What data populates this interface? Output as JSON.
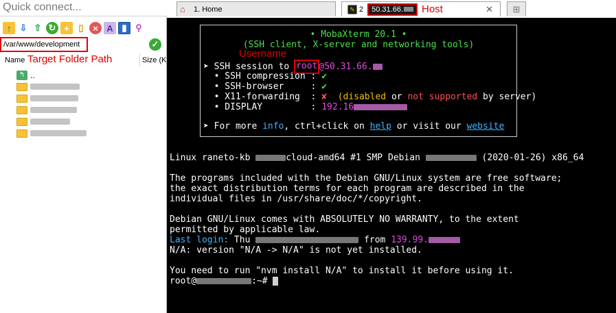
{
  "quick_connect": {
    "placeholder": "Quick connect..."
  },
  "sidebar_toolbar": {
    "icons": [
      "up-folder-icon",
      "download-icon",
      "upload-icon",
      "refresh-icon",
      "new-folder-icon",
      "new-file-icon",
      "delete-icon",
      "rename-icon",
      "follow-terminal-icon",
      "settings-wand-icon"
    ]
  },
  "path": {
    "value": "/var/www/development",
    "annotation": "Target Folder Path"
  },
  "file_columns": {
    "name": "Name",
    "size": "Size (K"
  },
  "file_list": [
    {
      "name": "..",
      "type": "up"
    },
    {
      "name": "",
      "type": "folder"
    },
    {
      "name": "",
      "type": "folder"
    },
    {
      "name": "",
      "type": "folder"
    },
    {
      "name": "",
      "type": "folder"
    },
    {
      "name": "",
      "type": "folder"
    }
  ],
  "tabs": {
    "home_label": "1. Home",
    "active_prefix": "2",
    "host_label": "50.31.66.",
    "host_annotation": "Host",
    "new_tab_icon": "plus-icon"
  },
  "banner": {
    "title": "• MobaXterm 20.1 •",
    "subtitle": "(SSH client, X-server and networking tools)",
    "ssh_session_prefix": "➤ SSH session to ",
    "ssh_user": "root",
    "ssh_host": "@50.31.66.",
    "compression_label": "  • SSH compression : ",
    "compression_value": "✔",
    "browser_label": "  • SSH-browser     : ",
    "browser_value": "✔",
    "x11_label": "  • X11-forwarding  : ",
    "x11_value": "✘",
    "x11_disabled": "(disabled",
    "x11_or": " or ",
    "x11_not_supported": "not supported",
    "x11_suffix": " by server)",
    "display_label": "  • DISPLAY         : ",
    "display_value": "192.16",
    "more_prefix": "➤ For more ",
    "more_info": "info",
    "more_middle": ", ctrl+click on ",
    "more_help": "help",
    "more_or": " or visit our ",
    "more_website": "website",
    "username_annotation": "Username"
  },
  "terminal_output": {
    "linux_prefix": "Linux raneto-kb ",
    "linux_mid": "cloud-amd64 #1 SMP Debian ",
    "linux_suffix": " (2020-01-26) x86_64",
    "programs_1": "The programs included with the Debian GNU/Linux system are free software;",
    "programs_2": "the exact distribution terms for each program are described in the",
    "programs_3": "individual files in /usr/share/doc/*/copyright.",
    "warranty_1": "Debian GNU/Linux comes with ABSOLUTELY NO WARRANTY, to the extent",
    "warranty_2": "permitted by applicable law.",
    "last_login_label": "Last login:",
    "last_login_day": " Thu ",
    "last_login_from": " from ",
    "last_login_ip": "139.99.",
    "nvm_version": "N/A: version \"N/A -> N/A\" is not yet installed.",
    "nvm_install": "You need to run \"nvm install N/A\" to install it before using it.",
    "prompt_user": "root@",
    "prompt_suffix": ":~# "
  },
  "colors": {
    "terminal_bg": "#000000",
    "annotation_red": "#e00000",
    "ok_green": "#4be04b",
    "info_blue": "#3db4ff",
    "host_magenta": "#e34ae3"
  }
}
